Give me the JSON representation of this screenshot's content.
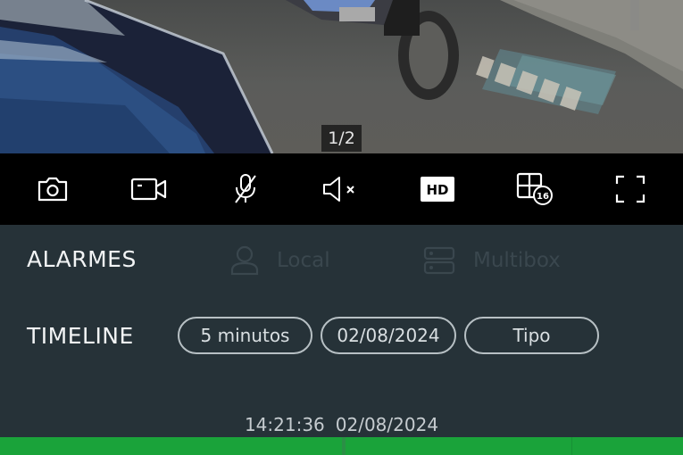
{
  "player": {
    "page_indicator": "1/2"
  },
  "toolbar": {
    "buttons": [
      {
        "icon": "camera-icon"
      },
      {
        "icon": "video-camera-icon"
      },
      {
        "icon": "microphone-off-icon"
      },
      {
        "icon": "speaker-muted-icon"
      },
      {
        "icon": "hd-icon",
        "label": "HD"
      },
      {
        "icon": "grid-16-icon",
        "badge": "16"
      },
      {
        "icon": "fullscreen-icon"
      }
    ]
  },
  "alarms": {
    "label": "ALARMES",
    "options": [
      {
        "label": "Local",
        "icon": "user-icon"
      },
      {
        "label": "Multibox",
        "icon": "multibox-icon"
      }
    ]
  },
  "timeline": {
    "label": "TIMELINE",
    "filters": [
      {
        "label": "5 minutos"
      },
      {
        "label": "02/08/2024"
      },
      {
        "label": "Tipo"
      }
    ],
    "time": "14:21:36",
    "date": "02/08/2024"
  },
  "colors": {
    "panel_bg": "#263238",
    "toolbar_bg": "#000000",
    "timeline_green": "#1aa33a",
    "pill_border": "#b7c0c4"
  }
}
